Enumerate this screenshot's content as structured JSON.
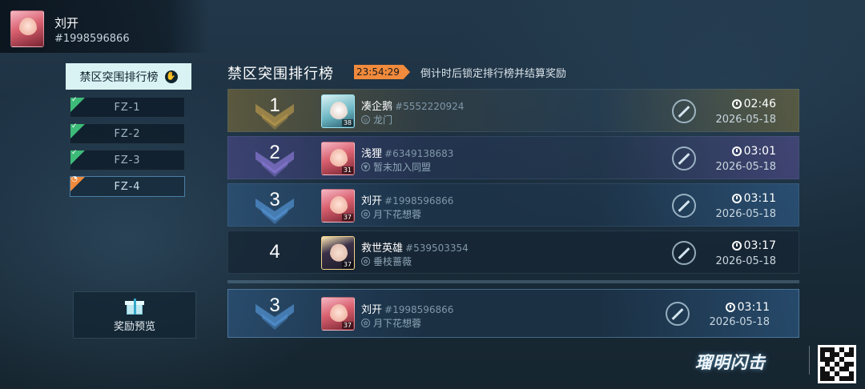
{
  "player": {
    "name": "刘开",
    "id": "#1998596866"
  },
  "nav": {
    "main_tab": "禁区突围排行榜",
    "stages": [
      {
        "label": "FZ-1",
        "status": "cleared"
      },
      {
        "label": "FZ-2",
        "status": "cleared"
      },
      {
        "label": "FZ-3",
        "status": "cleared"
      },
      {
        "label": "FZ-4",
        "status": "in-progress"
      }
    ],
    "reward_preview": "奖励预览"
  },
  "board": {
    "title": "禁区突围排行榜",
    "countdown": "23:54:29",
    "countdown_note": "倒计时后锁定排行榜并结算奖励",
    "rows": [
      {
        "rank": "1",
        "name": "凑企鹅",
        "id": "#5552220924",
        "level": "38",
        "guild": "龙门",
        "time": "02:46",
        "date": "2026-05-18",
        "tier": "gold"
      },
      {
        "rank": "2",
        "name": "浅狸",
        "id": "#6349138683",
        "level": "31",
        "guild": "暂未加入同盟",
        "time": "03:01",
        "date": "2026-05-18",
        "tier": "purple"
      },
      {
        "rank": "3",
        "name": "刘开",
        "id": "#1998596866",
        "level": "37",
        "guild": "月下花想蓉",
        "time": "03:11",
        "date": "2026-05-18",
        "tier": "blue"
      },
      {
        "rank": "4",
        "name": "救世英雄",
        "id": "#539503354",
        "level": "37",
        "guild": "垂枝蔷薇",
        "time": "03:17",
        "date": "2026-05-18",
        "tier": "plain"
      }
    ],
    "self_row": {
      "rank": "3",
      "name": "刘开",
      "id": "#1998596866",
      "level": "37",
      "guild": "月下花想蓉",
      "time": "03:11",
      "date": "2026-05-18"
    }
  },
  "branding": {
    "logo": "瑠明闪击"
  },
  "colors": {
    "accent_orange": "#f08a3c",
    "cleared_green": "#3dbb78",
    "tab_bg": "#d9f2f3"
  }
}
